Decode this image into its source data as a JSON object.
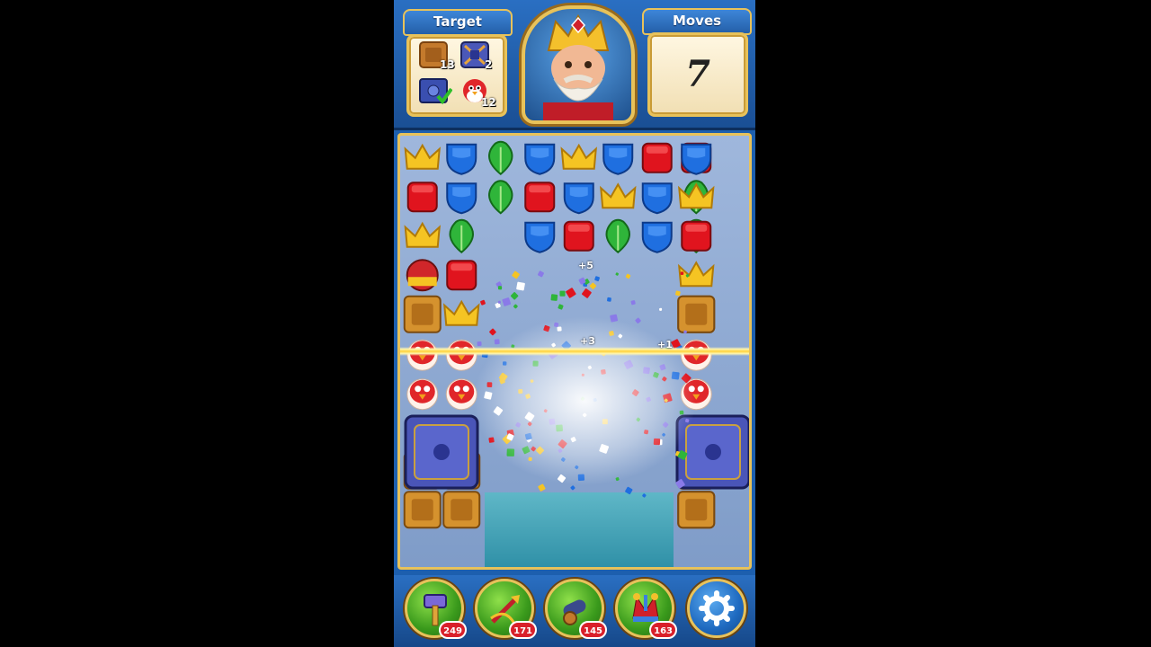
{
  "header": {
    "target_title": "Target",
    "moves_title": "Moves",
    "moves_left": "7",
    "targets": [
      {
        "icon": "wooden-box-icon",
        "count": "13"
      },
      {
        "icon": "metal-box-icon",
        "count": "2"
      },
      {
        "icon": "safe-icon",
        "count": "",
        "completed": true
      },
      {
        "icon": "red-bird-icon",
        "count": "12"
      }
    ]
  },
  "boosters": [
    {
      "icon": "hammer-icon",
      "count": "249"
    },
    {
      "icon": "arrow-icon",
      "count": "171"
    },
    {
      "icon": "cannon-icon",
      "count": "145"
    },
    {
      "icon": "jester-hat-icon",
      "count": "163"
    }
  ],
  "effects": [
    "+5",
    "+3",
    "+1"
  ],
  "colors": {
    "accent_gold": "#e8c25a",
    "header_blue": "#2a6fc2",
    "badge_red": "#d9202a"
  }
}
